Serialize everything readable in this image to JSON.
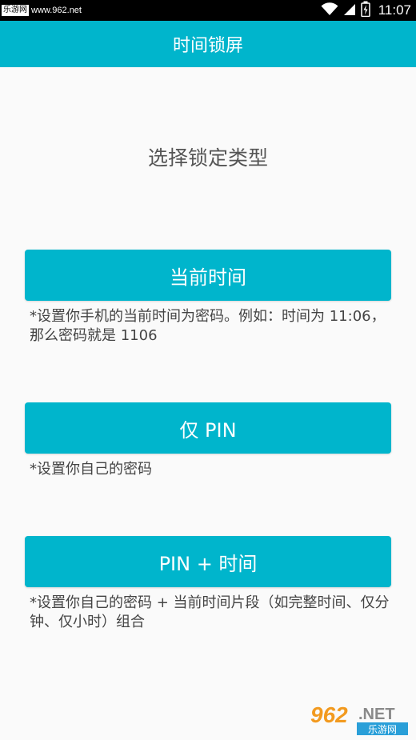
{
  "status_bar": {
    "watermark_label": "乐游网",
    "watermark_url": "www.962.net",
    "time": "11:07",
    "icons": [
      "wifi-icon",
      "signal-icon",
      "battery-icon"
    ]
  },
  "app_bar": {
    "title": "时间锁屏"
  },
  "main": {
    "heading": "选择锁定类型",
    "options": [
      {
        "label": "当前时间",
        "description": "*设置你手机的当前时间为密码。例如：时间为 11:06，那么密码就是 1106"
      },
      {
        "label": "仅 PIN",
        "description": "*设置你自己的密码"
      },
      {
        "label": "PIN + 时间",
        "description": "*设置你自己的密码 + 当前时间片段（如完整时间、仅分钟、仅小时）组合"
      }
    ]
  },
  "watermark_bottom": {
    "number": "962",
    "suffix": ".NET",
    "text": "乐游网"
  },
  "colors": {
    "primary": "#00b5cc",
    "background": "#fafafa",
    "text_dark": "#444444",
    "status_bar": "#000000"
  }
}
